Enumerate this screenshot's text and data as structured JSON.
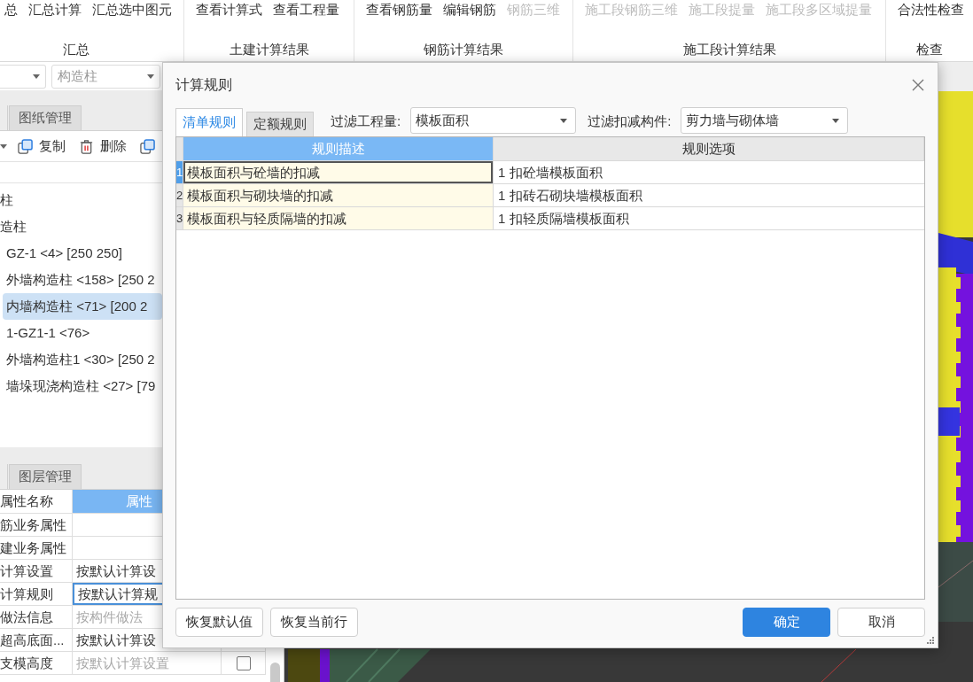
{
  "ribbon": {
    "groups": [
      {
        "label": "汇总",
        "buttons": [
          {
            "label": "总",
            "disabled": false
          },
          {
            "label": "汇总计算",
            "disabled": false
          },
          {
            "label": "汇总选中图元",
            "disabled": false
          }
        ]
      },
      {
        "label": "土建计算结果",
        "buttons": [
          {
            "label": "查看计算式",
            "disabled": false
          },
          {
            "label": "查看工程量",
            "disabled": false
          }
        ]
      },
      {
        "label": "钢筋计算结果",
        "buttons": [
          {
            "label": "查看钢筋量",
            "disabled": false
          },
          {
            "label": "编辑钢筋",
            "disabled": false
          },
          {
            "label": "钢筋三维",
            "disabled": true
          }
        ]
      },
      {
        "label": "施工段计算结果",
        "buttons": [
          {
            "label": "施工段钢筋三维",
            "disabled": true
          },
          {
            "label": "施工段提量",
            "disabled": true
          },
          {
            "label": "施工段多区域提量",
            "disabled": true
          }
        ]
      },
      {
        "label": "检查",
        "buttons": [
          {
            "label": "合法性检查",
            "disabled": false
          }
        ]
      }
    ]
  },
  "component_panel": {
    "dropdowns": [
      {
        "kind": "blank"
      },
      {
        "kind": "hint",
        "placeholder": "构造柱"
      }
    ],
    "tabs": [
      {
        "label": "图纸管理",
        "selected": false
      }
    ],
    "toolbar": [
      {
        "kind": "menu-caret"
      },
      {
        "kind": "copy",
        "label": "复制"
      },
      {
        "kind": "delete",
        "label": "删除"
      },
      {
        "kind": "copy"
      }
    ],
    "tree": [
      {
        "label": "柱",
        "selected": false,
        "children": [
          {
            "label": "造柱",
            "selected": false,
            "children": [
              {
                "label": "GZ-1 <4> [250 250]",
                "selected": false
              },
              {
                "label": "外墙构造柱 <158> [250 2",
                "selected": false
              },
              {
                "label": "内墙构造柱 <71> [200 2",
                "selected": true
              },
              {
                "label": "1-GZ1-1 <76>",
                "selected": false
              },
              {
                "label": "外墙构造柱1 <30> [250 2",
                "selected": false
              },
              {
                "label": "墙垛现浇构造柱 <27> [79",
                "selected": false
              }
            ]
          }
        ]
      }
    ]
  },
  "property_panel": {
    "tabs": [
      {
        "label": "图层管理",
        "selected": false
      }
    ],
    "columns": [
      {
        "label": "属性名称",
        "selected": false
      },
      {
        "label": "属性",
        "selected": true
      }
    ],
    "rows": [
      {
        "name": "筋业务属性",
        "selected": false
      },
      {
        "name": "建业务属性",
        "selected": false
      },
      {
        "name": "计算设置",
        "value": "按默认计算设",
        "disabled": false,
        "selected": false
      },
      {
        "name": "计算规则",
        "value": "按默认计算规",
        "disabled": false,
        "selected": true
      },
      {
        "name": "做法信息",
        "value": "按构件做法",
        "disabled": true,
        "selected": false
      },
      {
        "name": "超高底面...",
        "value": "按默认计算设",
        "disabled": false,
        "selected": false
      },
      {
        "name": "支模高度",
        "value": "按默认计算设置",
        "disabled": true,
        "selected": false,
        "checked": false
      }
    ]
  },
  "dialog": {
    "title": "计算规则",
    "tabs": [
      {
        "label": "清单规则",
        "selected": true
      },
      {
        "label": "定额规则",
        "selected": false
      }
    ],
    "filters": [
      {
        "label": "过滤工程量:",
        "value": "模板面积"
      },
      {
        "label": "过滤扣减构件:",
        "value": "剪力墙与砌体墙"
      }
    ],
    "columns": [
      {
        "label": "规则描述",
        "selected": true
      },
      {
        "label": "规则选项",
        "selected": false
      }
    ],
    "rows": [
      {
        "number": "1",
        "description": "模板面积与砼墙的扣减",
        "option": "1 扣砼墙模板面积",
        "selected": true
      },
      {
        "number": "2",
        "description": "模板面积与砌块墙的扣减",
        "option": "1 扣砖石砌块墙模板面积",
        "selected": false
      },
      {
        "number": "3",
        "description": "模板面积与轻质隔墙的扣减",
        "option": "1 扣轻质隔墙模板面积",
        "selected": false
      }
    ],
    "left_buttons": [
      {
        "label": "恢复默认值",
        "kind": "secondary"
      },
      {
        "label": "恢复当前行",
        "kind": "secondary"
      }
    ],
    "right_buttons": [
      {
        "label": "确定",
        "kind": "primary"
      },
      {
        "label": "取消",
        "kind": "secondary"
      }
    ]
  }
}
